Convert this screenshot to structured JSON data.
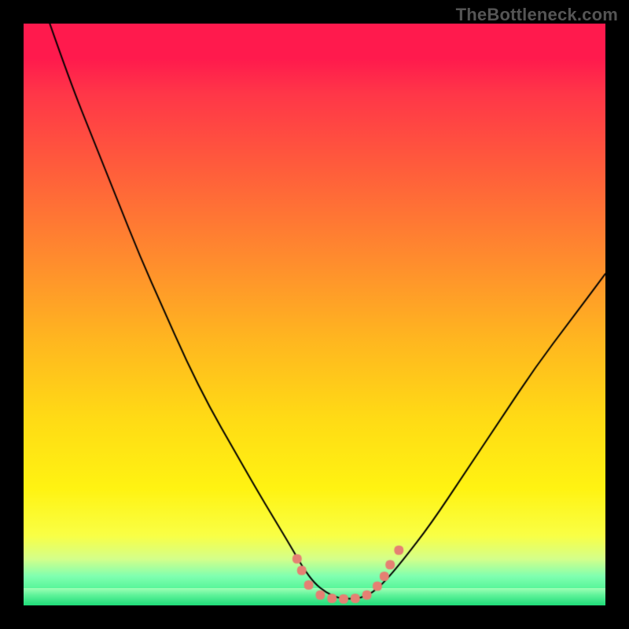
{
  "watermark": "TheBottleneck.com",
  "chart_data": {
    "type": "line",
    "title": "",
    "xlabel": "",
    "ylabel": "",
    "xlim": [
      0,
      100
    ],
    "ylim": [
      0,
      100
    ],
    "background_gradient": {
      "direction": "vertical",
      "stops": [
        {
          "pos": 0.0,
          "color": "#ff1a4d"
        },
        {
          "pos": 0.12,
          "color": "#ff3648"
        },
        {
          "pos": 0.24,
          "color": "#ff5a3c"
        },
        {
          "pos": 0.4,
          "color": "#ff8a2e"
        },
        {
          "pos": 0.55,
          "color": "#ffb81f"
        },
        {
          "pos": 0.68,
          "color": "#ffdb15"
        },
        {
          "pos": 0.8,
          "color": "#fff312"
        },
        {
          "pos": 0.92,
          "color": "#d4ff8a"
        },
        {
          "pos": 1.0,
          "color": "#20e87a"
        }
      ]
    },
    "series": [
      {
        "name": "bottleneck-curve",
        "color": "#000000",
        "width": 2,
        "x": [
          4.5,
          8,
          12,
          16,
          20,
          24,
          28,
          32,
          36,
          40,
          43,
          46,
          48,
          50,
          52,
          54,
          56,
          58,
          60,
          62,
          65,
          70,
          76,
          82,
          88,
          94,
          100
        ],
        "y": [
          100,
          90,
          80,
          70,
          60,
          51,
          42,
          34,
          27,
          20,
          15,
          10,
          6.5,
          3.8,
          2.2,
          1.3,
          1.1,
          1.3,
          2.2,
          4.0,
          7.5,
          14,
          23,
          32,
          41,
          49,
          57
        ]
      }
    ],
    "markers": {
      "name": "valley-dots",
      "color": "#e58073",
      "radius": 6,
      "shape": "rounded-square",
      "points": [
        {
          "x": 47.0,
          "y": 8.0
        },
        {
          "x": 47.8,
          "y": 6.0
        },
        {
          "x": 49.0,
          "y": 3.5
        },
        {
          "x": 51.0,
          "y": 1.8
        },
        {
          "x": 53.0,
          "y": 1.2
        },
        {
          "x": 55.0,
          "y": 1.1
        },
        {
          "x": 57.0,
          "y": 1.2
        },
        {
          "x": 59.0,
          "y": 1.8
        },
        {
          "x": 60.8,
          "y": 3.3
        },
        {
          "x": 62.0,
          "y": 5.0
        },
        {
          "x": 63.0,
          "y": 7.0
        },
        {
          "x": 64.5,
          "y": 9.5
        }
      ]
    }
  }
}
